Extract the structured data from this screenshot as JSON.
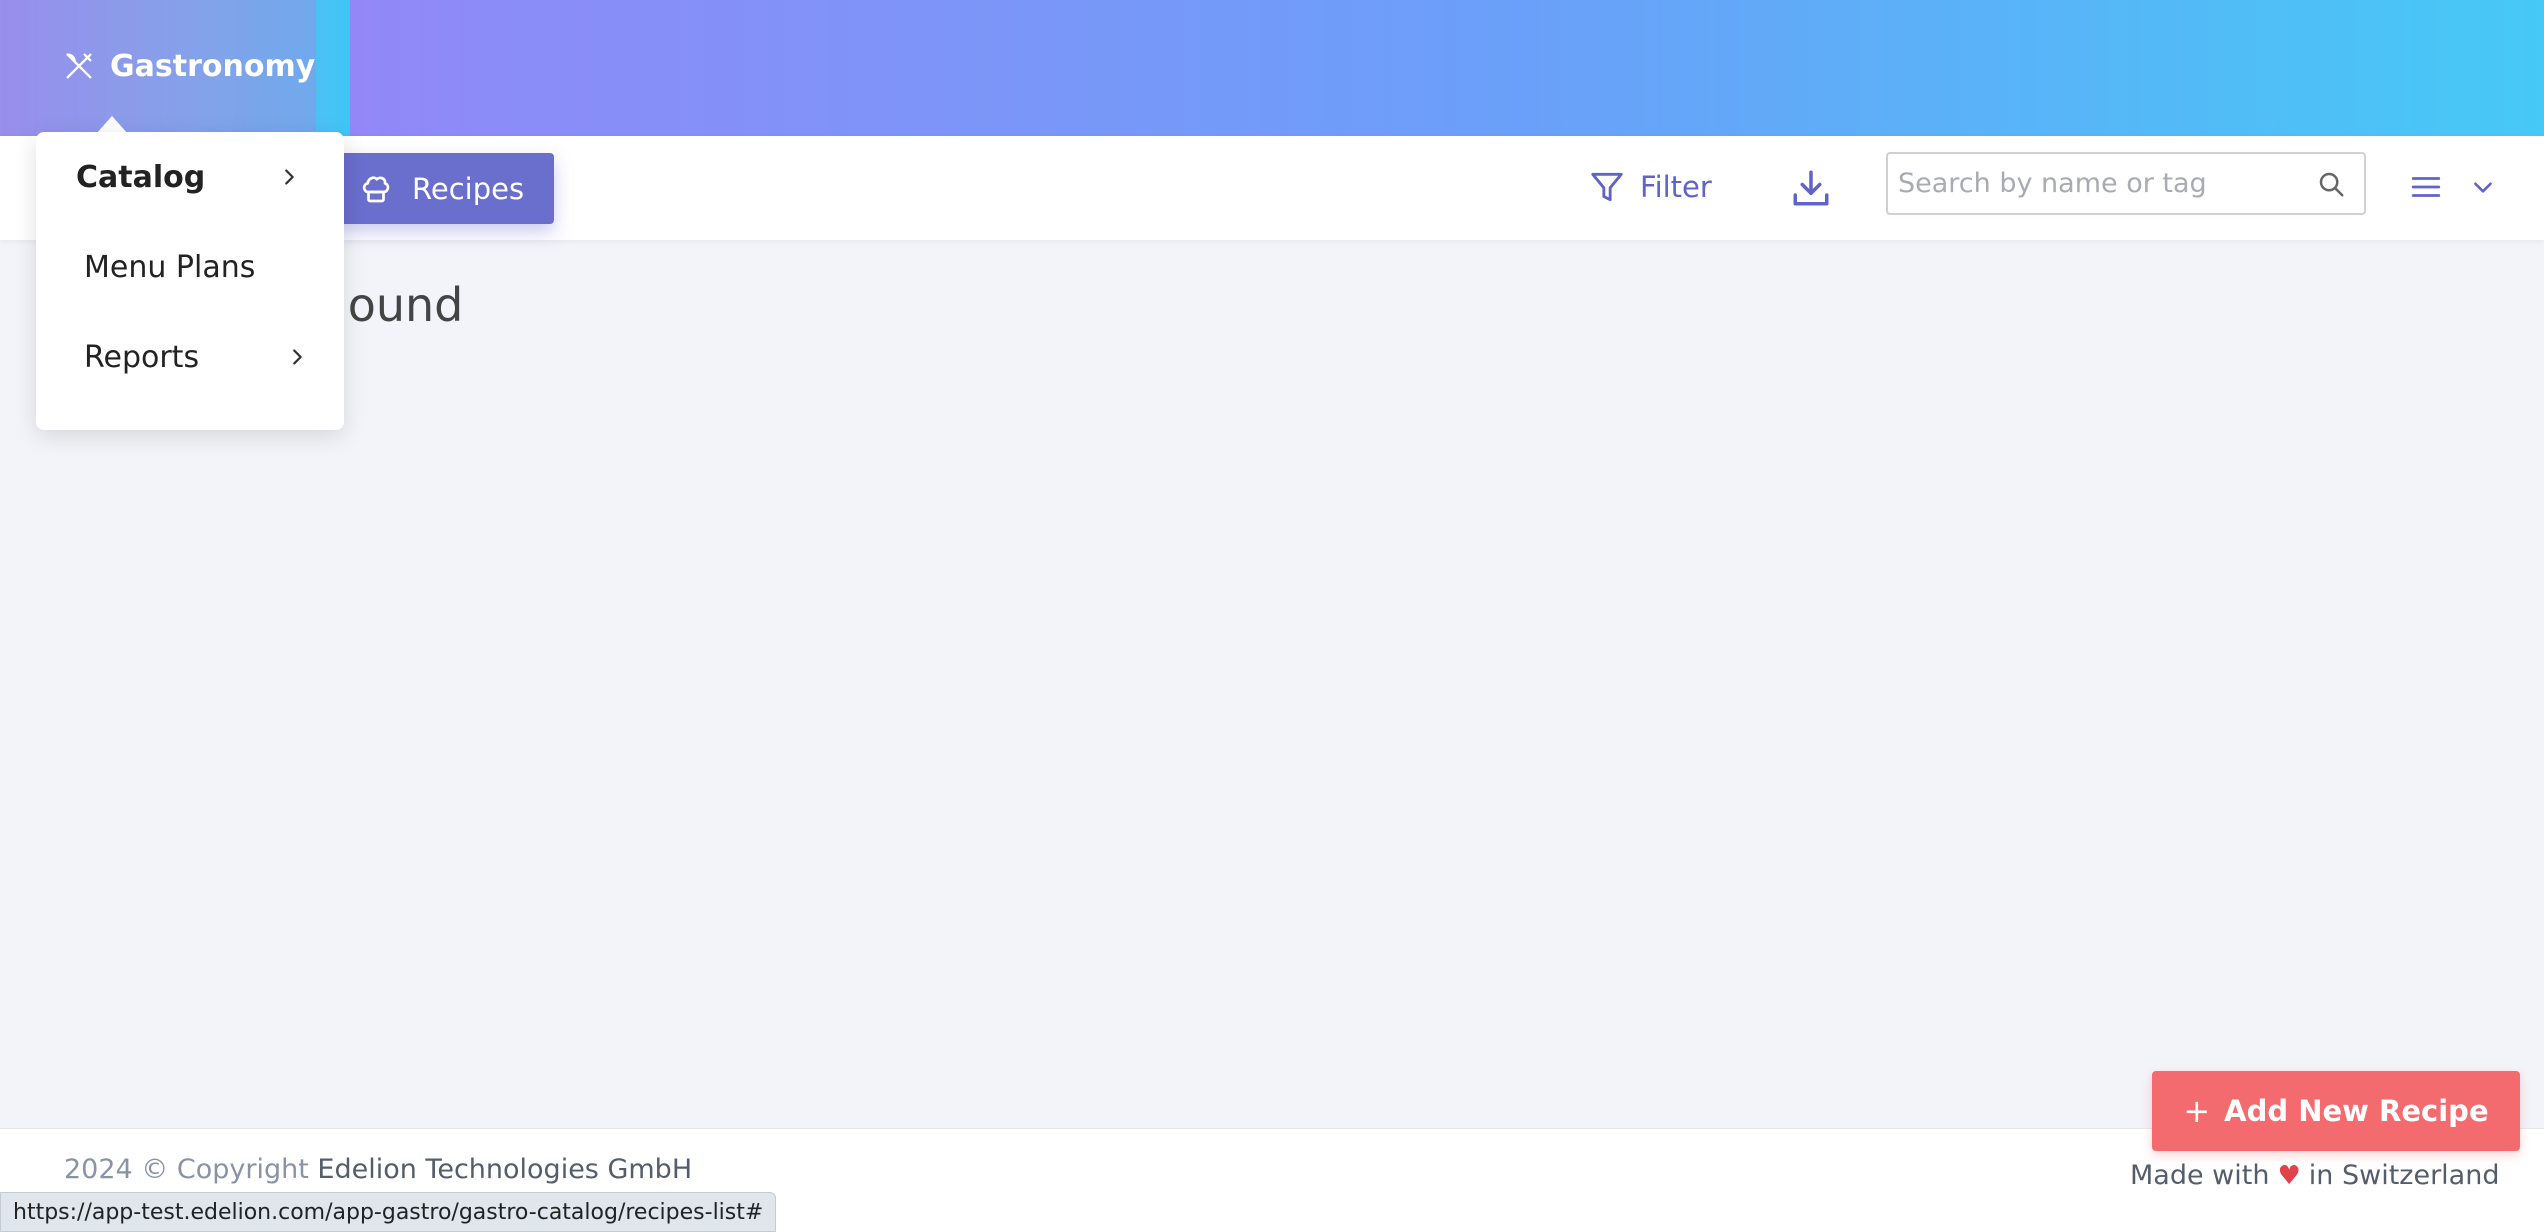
{
  "header": {
    "brand_label": "Gastronomy"
  },
  "toolbar": {
    "active_tab_label": "Recipes",
    "filter_label": "Filter",
    "search_placeholder": "Search by name or tag",
    "search_value": ""
  },
  "main": {
    "empty_message": "ound"
  },
  "dropdown": {
    "items": [
      {
        "label": "Catalog",
        "has_submenu": true
      },
      {
        "label": "Menu Plans",
        "has_submenu": false
      },
      {
        "label": "Reports",
        "has_submenu": true
      }
    ]
  },
  "fab": {
    "plus": "+",
    "label": "Add New Recipe"
  },
  "footer": {
    "year_copyright": "2024 © Copyright",
    "company": "Edelion Technologies GmbH",
    "made_with": "Made with",
    "heart": "♥",
    "in_country": "in Switzerland"
  },
  "status_bar": {
    "url": "https://app-test.edelion.com/app-gastro/gastro-catalog/recipes-list#"
  },
  "colors": {
    "accent": "#6a6ecd",
    "add_button": "#f36a6f",
    "background": "#f3f4f9"
  }
}
